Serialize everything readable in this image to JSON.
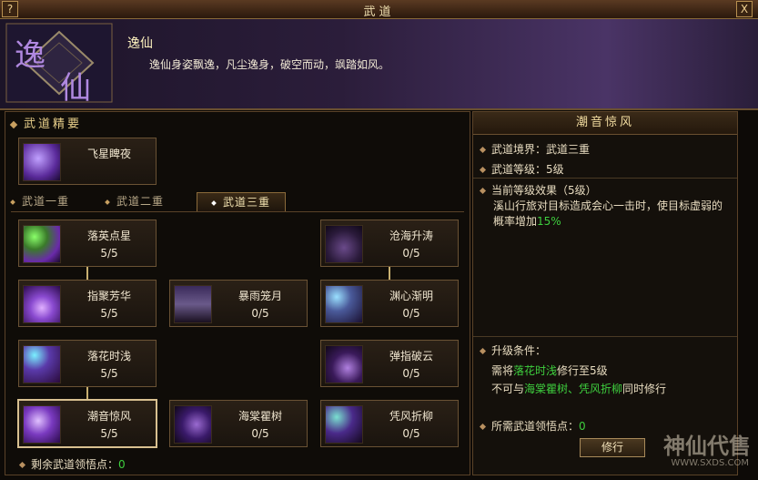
{
  "window": {
    "title": "武道",
    "help": "?",
    "close": "X"
  },
  "header": {
    "title": "逸仙",
    "desc": "逸仙身姿飘逸，凡尘逸身，破空而动，飒踏如风。",
    "emblem_chars": [
      "逸",
      "仙"
    ]
  },
  "left": {
    "section_title": "武道精要",
    "essence": {
      "name": "飞星睥夜"
    },
    "tabs": [
      "武道一重",
      "武道二重",
      "武道三重"
    ],
    "active_tab": 2,
    "nodes": [
      {
        "name": "落英点星",
        "level": "5/5",
        "icon": "swirl-green"
      },
      {
        "name": "沧海升涛",
        "level": "0/5",
        "icon": "trident"
      },
      {
        "name": "指聚芳华",
        "level": "5/5",
        "icon": "trident"
      },
      {
        "name": "暴雨笼月",
        "level": "0/5",
        "icon": "storm"
      },
      {
        "name": "渊心渐明",
        "level": "0/5",
        "icon": "orb"
      },
      {
        "name": "落花时浅",
        "level": "5/5",
        "icon": "orb"
      },
      {
        "name": "弹指破云",
        "level": "0/5",
        "icon": "trident"
      },
      {
        "name": "潮音惊风",
        "level": "5/5",
        "icon": "wind"
      },
      {
        "name": "海棠瞿树",
        "level": "0/5",
        "icon": "blade"
      },
      {
        "name": "凭风折柳",
        "level": "0/5",
        "icon": "orb"
      }
    ],
    "remaining_label": "剩余武道领悟点：",
    "remaining_value": "0"
  },
  "right": {
    "title": "潮音惊风",
    "realm_label": "武道境界：",
    "realm_value": "武道三重",
    "grade_label": "武道等级：",
    "grade_value": "5级",
    "effect_label": "当前等级效果（5级）",
    "effect_text": "溪山行旅对目标造成会心一击时，使目标虚弱的概率增加",
    "effect_value": "15%",
    "upgrade_label": "升级条件：",
    "req1_pre": "需将",
    "req1_skill": "落花时浅",
    "req1_post": "修行至5级",
    "req2_pre": "不可与",
    "req2_skill": "海棠瞿树、凭风折柳",
    "req2_post": "同时修行",
    "points_label": "所需武道领悟点：",
    "points_value": "0",
    "train_button": "修行"
  },
  "watermark": {
    "text": "神仙代售",
    "url": "WWW.SXDS.COM"
  },
  "colors": {
    "accent": "#e8cf8a",
    "green": "#3ecf3e",
    "gold_border": "#6a5234"
  }
}
